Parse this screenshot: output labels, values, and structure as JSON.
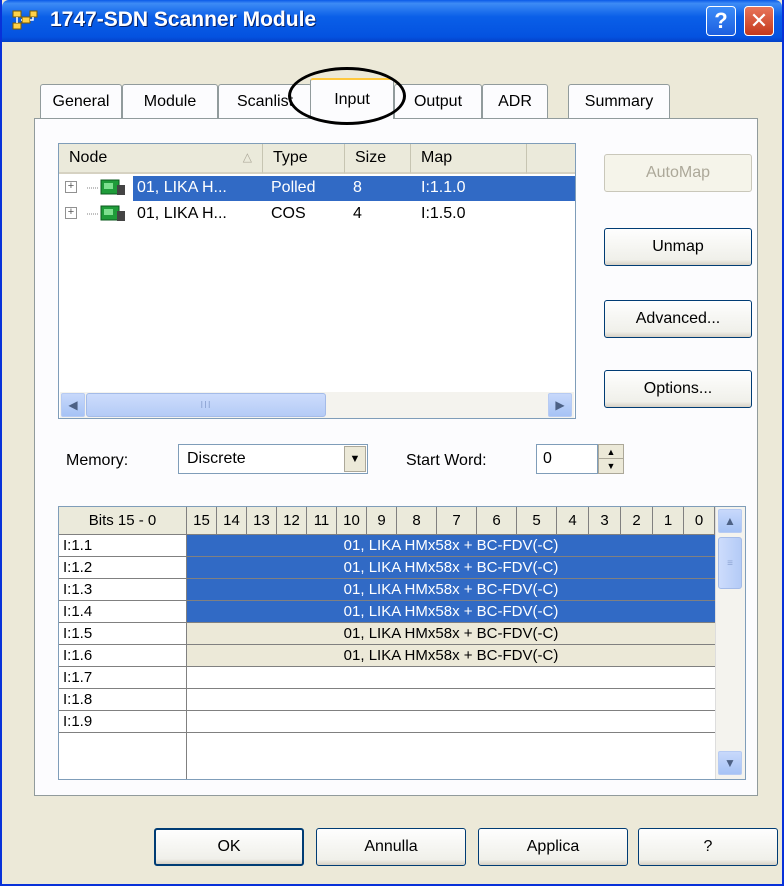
{
  "window": {
    "title": "1747-SDN Scanner Module",
    "help_glyph": "?",
    "close_glyph": "✕"
  },
  "tabs": [
    {
      "label": "General"
    },
    {
      "label": "Module"
    },
    {
      "label": "Scanlist"
    },
    {
      "label": "Input",
      "active": true
    },
    {
      "label": "Output"
    },
    {
      "label": "ADR"
    },
    {
      "label": "Summary"
    }
  ],
  "node_list": {
    "columns": [
      "Node",
      "Type",
      "Size",
      "Map"
    ],
    "sort_glyph": "△",
    "rows": [
      {
        "node": "01, LIKA H...",
        "type": "Polled",
        "size": "8",
        "map": "I:1.1.0",
        "selected": true
      },
      {
        "node": "01, LIKA H...",
        "type": "COS",
        "size": "4",
        "map": "I:1.5.0",
        "selected": false
      }
    ],
    "expander": "+",
    "scroll": {
      "left": "◀",
      "right": "▶",
      "grip": "III"
    }
  },
  "side_buttons": {
    "automap": "AutoMap",
    "unmap": "Unmap",
    "advanced": "Advanced...",
    "options": "Options..."
  },
  "memory": {
    "label": "Memory:",
    "value": "Discrete",
    "arrow": "▼"
  },
  "start_word": {
    "label": "Start Word:",
    "value": "0",
    "up": "▲",
    "down": "▼"
  },
  "bit_grid": {
    "header_label": "Bits 15 - 0",
    "bits": [
      "15",
      "14",
      "13",
      "12",
      "11",
      "10",
      "9",
      "8",
      "7",
      "6",
      "5",
      "4",
      "3",
      "2",
      "1",
      "0"
    ],
    "rows": [
      {
        "addr": "I:1.1",
        "device": "01, LIKA HMx58x + BC-FDV(-C)",
        "state": "sel"
      },
      {
        "addr": "I:1.2",
        "device": "01, LIKA HMx58x + BC-FDV(-C)",
        "state": "sel"
      },
      {
        "addr": "I:1.3",
        "device": "01, LIKA HMx58x + BC-FDV(-C)",
        "state": "sel"
      },
      {
        "addr": "I:1.4",
        "device": "01, LIKA HMx58x + BC-FDV(-C)",
        "state": "sel"
      },
      {
        "addr": "I:1.5",
        "device": "01, LIKA HMx58x + BC-FDV(-C)",
        "state": "norm"
      },
      {
        "addr": "I:1.6",
        "device": "01, LIKA HMx58x + BC-FDV(-C)",
        "state": "norm"
      },
      {
        "addr": "I:1.7",
        "device": "",
        "state": "empty"
      },
      {
        "addr": "I:1.8",
        "device": "",
        "state": "empty"
      },
      {
        "addr": "I:1.9",
        "device": "",
        "state": "empty"
      }
    ],
    "scroll": {
      "up": "▲",
      "down": "▼",
      "grip": "≡"
    }
  },
  "footer_buttons": {
    "ok": "OK",
    "cancel": "Annulla",
    "apply": "Applica",
    "help": "?"
  },
  "colors": {
    "titlebar": "#0a5fe8",
    "selection": "#316ac5",
    "face": "#ece9d8",
    "annotation": "#000000"
  }
}
